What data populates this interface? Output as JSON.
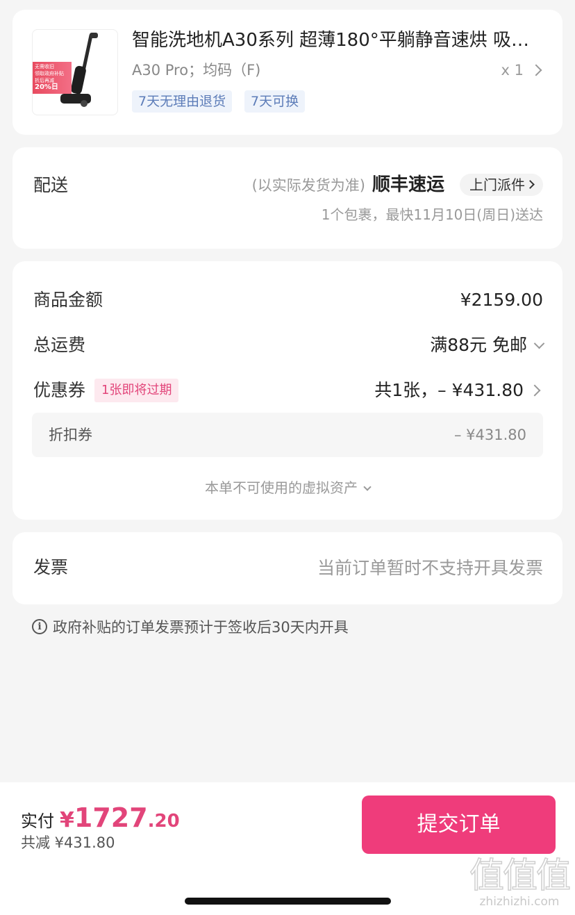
{
  "product": {
    "image_badge": {
      "line1": "无需收旧",
      "line2": "领取政府补贴",
      "line3": "折后再减",
      "pct": "20%日"
    },
    "title": "智能洗地机A30系列  超薄180°平躺静音速烘 吸…",
    "spec": "A30 Pro；均码（F)",
    "quantity": "x 1",
    "tags": [
      "7天无理由退货",
      "7天可换"
    ]
  },
  "delivery": {
    "label": "配送",
    "note": "(以实际发货为准)",
    "courier": "顺丰速运",
    "pickup": "上门派件",
    "eta": "1个包裹，最快11月10日(周日)送达"
  },
  "amounts": {
    "goods_label": "商品金额",
    "goods_value": "¥2159.00",
    "shipping_label": "总运费",
    "shipping_value": "满88元 免邮",
    "coupon_label": "优惠券",
    "coupon_tag": "1张即将过期",
    "coupon_value": "共1张，– ¥431.80",
    "discount_label": "折扣券",
    "discount_value": "– ¥431.80",
    "virtual_note": "本单不可使用的虚拟资产"
  },
  "invoice": {
    "label": "发票",
    "value": "当前订单暂时不支持开具发票"
  },
  "info": {
    "icon": "i",
    "text": "政府补贴的订单发票预计于签收后30天内开具"
  },
  "footer": {
    "pay_label": "实付",
    "currency": "¥",
    "amount_int": "1727",
    "amount_dec": ".20",
    "saved": "共减 ¥431.80",
    "submit": "提交订单"
  },
  "watermark": {
    "glyphs": "值值值",
    "url": "zhizhizhi.com"
  },
  "colors": {
    "accent": "#ef3c7b",
    "price": "#e2457a",
    "tag_bg": "#eef3fb",
    "tag_text": "#5c7cb8"
  }
}
